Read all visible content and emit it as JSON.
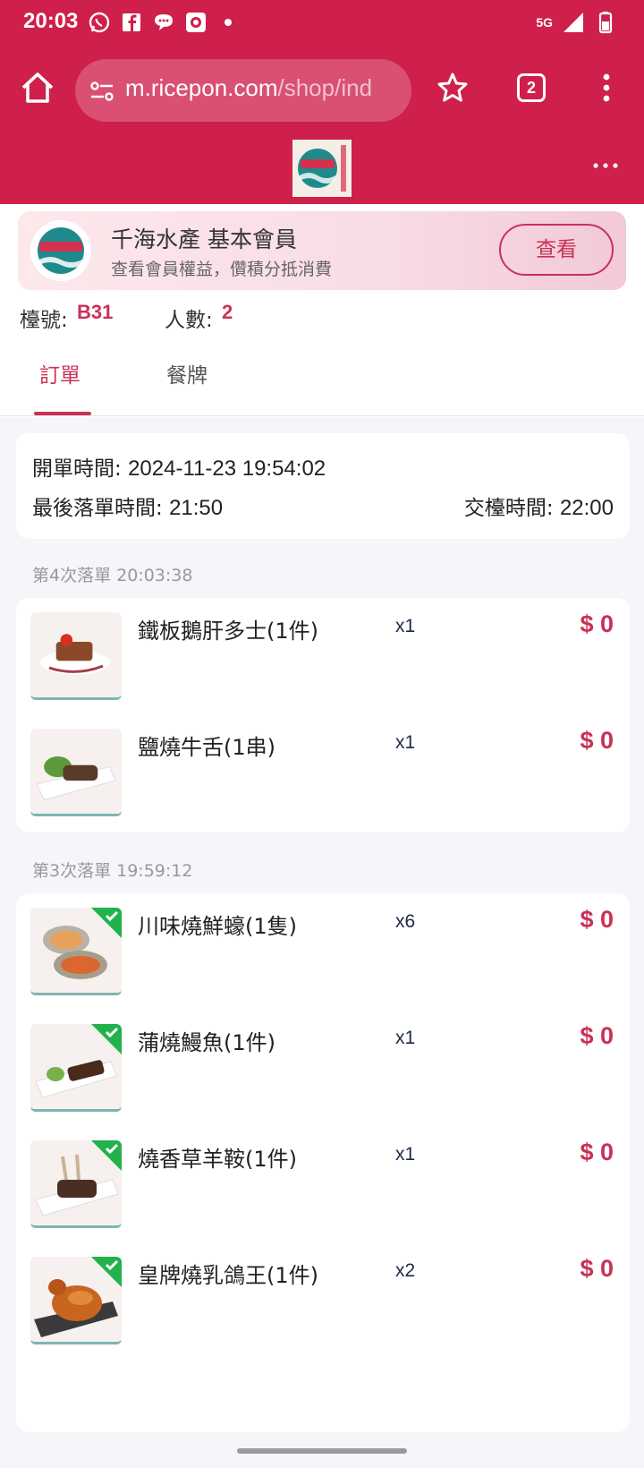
{
  "status_bar": {
    "time": "20:03",
    "network": "5G",
    "icons": [
      "whatsapp-icon",
      "facebook-icon",
      "chat-icon",
      "camera-icon",
      "dot-icon",
      "signal-icon",
      "battery-icon"
    ]
  },
  "browser": {
    "url_host": "m.ricepon.com",
    "url_path": "/shop/ind",
    "tab_count": "2"
  },
  "member": {
    "title": "千海水產 基本會員",
    "subtitle": "查看會員權益，儹積分抵消費",
    "view_button": "查看"
  },
  "table": {
    "table_label": "檯號:",
    "table_value": "B31",
    "people_label": "人數:",
    "people_value": "2"
  },
  "tabs": [
    {
      "label": "訂單",
      "active": true
    },
    {
      "label": "餐牌",
      "active": false
    }
  ],
  "times": {
    "open_label": "開單時間:",
    "open_value": "2024-11-23 19:54:02",
    "last_order_label": "最後落單時間:",
    "last_order_value": "21:50",
    "close_label": "交檯時間:",
    "close_value": "22:00"
  },
  "batches": [
    {
      "label": "第4次落單 20:03:38",
      "items": [
        {
          "name": "鐵板鵝肝多士(1件)",
          "qty": "x1",
          "price": "$ 0",
          "served": false
        },
        {
          "name": "鹽燒牛舌(1串)",
          "qty": "x1",
          "price": "$ 0",
          "served": false
        }
      ]
    },
    {
      "label": "第3次落單 19:59:12",
      "items": [
        {
          "name": "川味燒鮮蠔(1隻)",
          "qty": "x6",
          "price": "$ 0",
          "served": true
        },
        {
          "name": "蒲燒鰻魚(1件)",
          "qty": "x1",
          "price": "$ 0",
          "served": true
        },
        {
          "name": "燒香草羊鞍(1件)",
          "qty": "x1",
          "price": "$ 0",
          "served": true
        },
        {
          "name": "皇牌燒乳鴿王(1件)",
          "qty": "x2",
          "price": "$ 0",
          "served": true
        }
      ]
    }
  ],
  "colors": {
    "brand": "#cf1f4b",
    "accent": "#c93156",
    "served_check": "#21b24b"
  }
}
